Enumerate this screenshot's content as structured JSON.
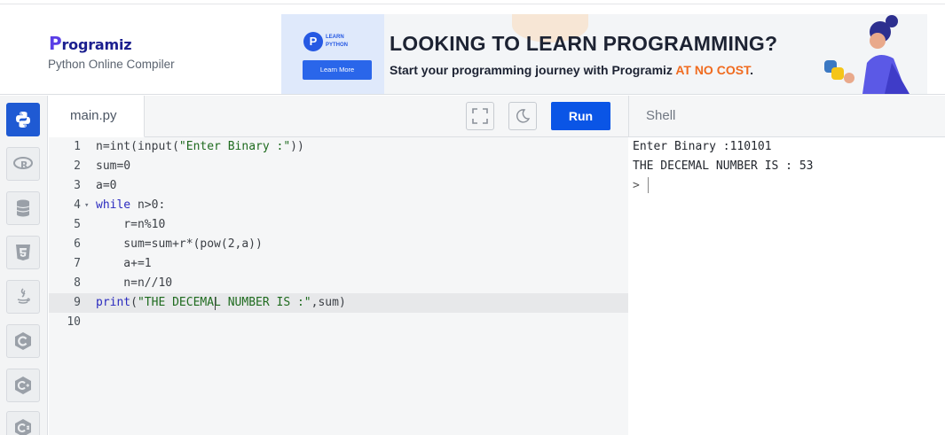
{
  "site": {
    "logo": "rogramiz",
    "logo_p": "P",
    "subtitle": "Python Online Compiler"
  },
  "ad": {
    "badge": "P",
    "badge_text": "LEARN PYTHON",
    "button": "Learn More",
    "headline": "LOOKING TO LEARN PROGRAMMING?",
    "sub_prefix": "Start your programming journey with Programiz ",
    "sub_highlight": "AT NO COST",
    "sub_suffix": ".",
    "accent_color": "#f06b1f"
  },
  "rail": {
    "items": [
      {
        "icon": "python-icon",
        "active": true
      },
      {
        "icon": "r-language-icon",
        "active": false
      },
      {
        "icon": "database-icon",
        "active": false
      },
      {
        "icon": "html5-icon",
        "active": false
      },
      {
        "icon": "java-icon",
        "active": false
      },
      {
        "icon": "c-language-icon",
        "active": false
      },
      {
        "icon": "cpp-icon",
        "active": false
      },
      {
        "icon": "csharp-icon",
        "active": false
      }
    ]
  },
  "editor": {
    "tab": "main.py",
    "run_label": "Run",
    "lines": [
      {
        "n": "1",
        "text": "n=int(input(\"Enter Binary :\"))"
      },
      {
        "n": "2",
        "text": "sum=0"
      },
      {
        "n": "3",
        "text": "a=0"
      },
      {
        "n": "4",
        "text": "while n>0:",
        "fold": true
      },
      {
        "n": "5",
        "text": "    r=n%10"
      },
      {
        "n": "6",
        "text": "    sum=sum+r*(pow(2,a))"
      },
      {
        "n": "7",
        "text": "    a+=1"
      },
      {
        "n": "8",
        "text": "    n=n//10"
      },
      {
        "n": "9",
        "text": "print(\"THE DECEMAL NUMBER IS :\",sum)",
        "active": true
      },
      {
        "n": "10",
        "text": ""
      }
    ]
  },
  "shell": {
    "title": "Shell",
    "output": [
      "Enter Binary :110101",
      "THE DECEMAL NUMBER IS : 53",
      ">"
    ]
  }
}
